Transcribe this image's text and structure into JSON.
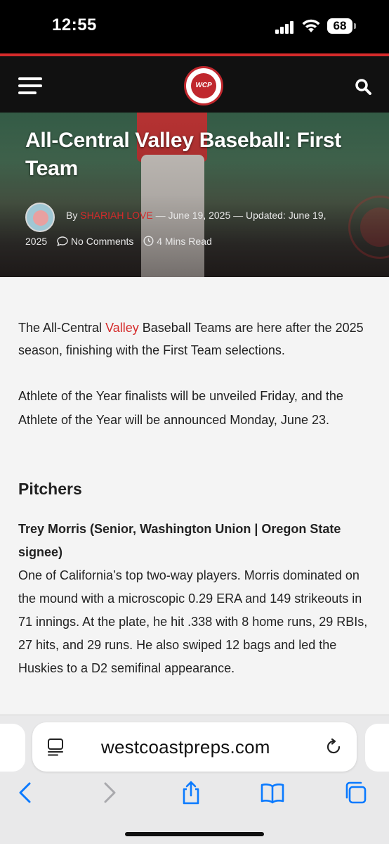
{
  "status_bar": {
    "time": "12:55",
    "battery": "68"
  },
  "site_header": {
    "logo_text": "WCP"
  },
  "hero": {
    "title": "All-Central Valley Baseball: First Team",
    "byline_prefix": "By",
    "author": "SHARIAH LOVE",
    "date": "June 19, 2025",
    "updated_label": "Updated:",
    "updated_date_part1": "June 19,",
    "updated_date_part2": "2025",
    "comments": "No Comments",
    "read_time": "4 Mins Read"
  },
  "article": {
    "intro_before_link": "The All-Central ",
    "intro_link": "Valley",
    "intro_after_link": " Baseball Teams are here after the 2025 season, finishing with the First Team selections.",
    "paragraph2": "Athlete of the Year finalists will be unveiled Friday, and the Athlete of the Year will be announced Monday, June 23.",
    "section_heading": "Pitchers",
    "player_heading": "Trey Morris (Senior, Washington Union | Oregon State signee)",
    "player_text": "One of California’s top two-way players. Morris dominated on the mound with a microscopic 0.29 ERA and 149 strikeouts in 71 innings. At the plate, he hit .338 with 8 home runs, 29 RBIs, 27 hits, and 29 runs. He also swiped 12 bags and led the Huskies to a D2 semifinal appearance."
  },
  "browser": {
    "url": "westcoastpreps.com"
  },
  "colors": {
    "accent_red": "#d52b2b",
    "header_bg": "#111111",
    "ios_blue": "#0a7aff"
  },
  "icons": [
    "menu-icon",
    "search-icon",
    "comment-icon",
    "clock-icon",
    "reader-icon",
    "reload-icon",
    "back-icon",
    "forward-icon",
    "share-icon",
    "bookmarks-icon",
    "tabs-icon"
  ]
}
